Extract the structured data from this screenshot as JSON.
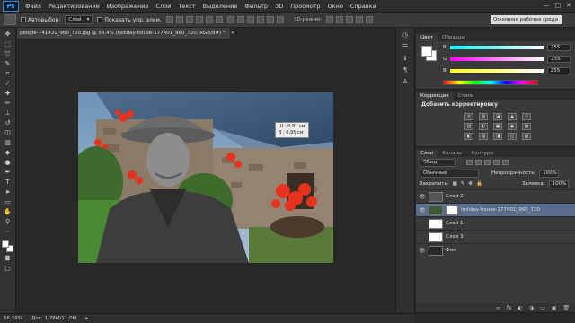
{
  "menu": [
    "Файл",
    "Редактирование",
    "Изображение",
    "Слои",
    "Текст",
    "Выделение",
    "Фильтр",
    "3D",
    "Просмотр",
    "Окно",
    "Справка"
  ],
  "app_logo": "Ps",
  "window_controls": [
    "—",
    "□",
    "✕"
  ],
  "options": {
    "autoselect_label": "Автовыбор:",
    "autoselect_value": "Слой",
    "show_controls_label": "Показать упр. элем.",
    "mode_3d": "3D-режим:",
    "workspace": "Основная рабочая среда"
  },
  "document": {
    "tab_title": "people-741431_960_720.jpg @ 56,4% (holiday-house-177401_960_720, RGB/8#) *",
    "close": "×"
  },
  "measure": {
    "x": "Ш : 0,81 см",
    "y": "В : 0,95 см"
  },
  "status": {
    "zoom": "56,29%",
    "doc_size": "Док: 1,76M/11,0M"
  },
  "color_panel": {
    "tabs": [
      "Цвет",
      "Образцы"
    ],
    "sliders": [
      {
        "label": "R",
        "value": "255",
        "gradient": "linear-gradient(90deg,#00ffff,#ffffff)"
      },
      {
        "label": "G",
        "value": "255",
        "gradient": "linear-gradient(90deg,#ff00ff,#ffffff)"
      },
      {
        "label": "B",
        "value": "255",
        "gradient": "linear-gradient(90deg,#ffff00,#ffffff)"
      }
    ]
  },
  "adjustments": {
    "tabs": [
      "Коррекция",
      "Стили"
    ],
    "title": "Добавить корректировку",
    "icons": [
      "☼",
      "▥",
      "◪",
      "▲",
      "▽",
      "▤",
      "◐",
      "▣",
      "◉",
      "▦",
      "◧",
      "▧",
      "◨",
      "◫",
      "▨"
    ]
  },
  "layers_panel": {
    "tabs": [
      "Слои",
      "Каналы",
      "Контуры"
    ],
    "kind": "Вид",
    "blend_mode": "Обычные",
    "opacity_label": "Непрозрачность:",
    "opacity": "100%",
    "lock_label": "Закрепить:",
    "fill_label": "Заливка:",
    "fill": "100%",
    "layers": [
      {
        "name": "Слой 2",
        "visible": true,
        "thumb": "#555555",
        "selected": false,
        "mask": false
      },
      {
        "name": "holiday-house-177401_960_720",
        "visible": true,
        "thumb": "#3c5a3a",
        "selected": true,
        "mask": true
      },
      {
        "name": "Слой 1",
        "visible": false,
        "thumb": "#ffffff",
        "selected": false,
        "mask": false
      },
      {
        "name": "Слой 3",
        "visible": false,
        "thumb": "#ffffff",
        "selected": false,
        "mask": false
      },
      {
        "name": "Фон",
        "visible": true,
        "thumb": "#2a2a2a",
        "selected": false,
        "mask": false
      }
    ],
    "footer_icons": [
      "∞",
      "fx",
      "◐",
      "◑",
      "▭",
      "▣",
      "🗑"
    ]
  }
}
